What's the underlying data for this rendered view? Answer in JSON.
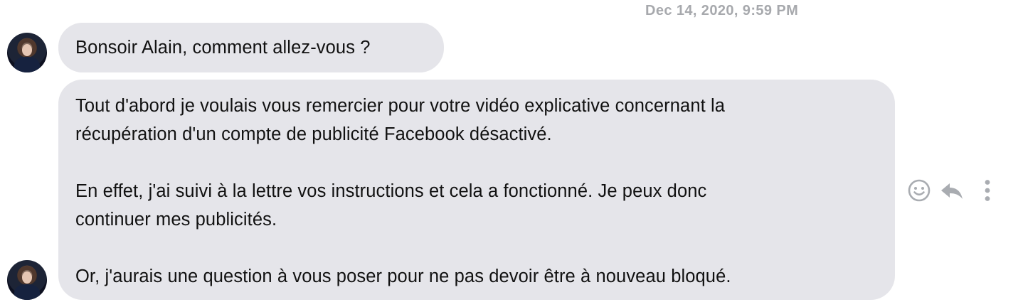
{
  "conversation": {
    "timestamp": "Dec 14, 2020, 9:59 PM",
    "messages": [
      {
        "lines": [
          "Bonsoir Alain, comment allez-vous ?"
        ]
      },
      {
        "lines": [
          "Tout d'abord je voulais vous remercier pour votre vidéo explicative concernant la",
          "récupération d'un compte de publicité Facebook désactivé.",
          "",
          "En effet, j'ai suivi à la lettre vos instructions et cela a fonctionné. Je peux donc",
          "continuer mes publicités.",
          "",
          "Or, j'aurais une question à vous poser pour ne pas devoir être à nouveau bloqué."
        ]
      }
    ]
  },
  "actions": {
    "react_icon": "smiley-icon",
    "reply_icon": "reply-arrow-icon",
    "more_icon": "more-vertical-icon"
  },
  "colors": {
    "bubble_bg": "#e5e5ea",
    "text": "#111111",
    "timestamp": "#a7a9ad",
    "icon": "#a9acb1"
  }
}
